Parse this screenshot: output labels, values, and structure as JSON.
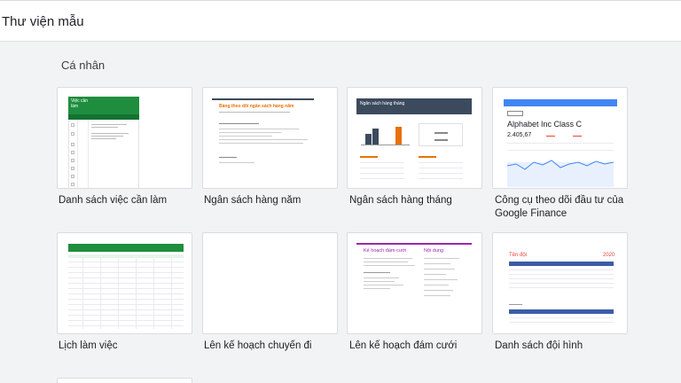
{
  "header": {
    "title": "Thư viện mẫu"
  },
  "section": {
    "title": "Cá nhân"
  },
  "templates": [
    {
      "label": "Danh sách việc cần làm",
      "thumb_title": "Việc cần làm"
    },
    {
      "label": "Ngân sách hàng năm",
      "thumb_title": "Bảng theo dõi ngân sách hàng năm"
    },
    {
      "label": "Ngân sách hàng tháng",
      "thumb_title": "Ngân sách hàng tháng"
    },
    {
      "label": "Công cụ theo dõi đầu tư của Google Finance",
      "thumb_title": "Alphabet Inc Class C",
      "thumb_value": "2.405,67"
    },
    {
      "label": "Lịch làm việc"
    },
    {
      "label": "Lên kế hoạch chuyến đi"
    },
    {
      "label": "Lên kế hoạch đám cưới",
      "thumb_title": "Kế hoạch đám cưới",
      "thumb_subtitle": "Nội dung"
    },
    {
      "label": "Danh sách đội hình",
      "thumb_title": "Tên đội",
      "thumb_year": "2020"
    }
  ],
  "colors": {
    "green": "#1e8e3e",
    "orange": "#e8710a",
    "navy": "#3c4a5e",
    "blue": "#4285f4",
    "purple": "#9c27b0",
    "red": "#ea4335"
  }
}
